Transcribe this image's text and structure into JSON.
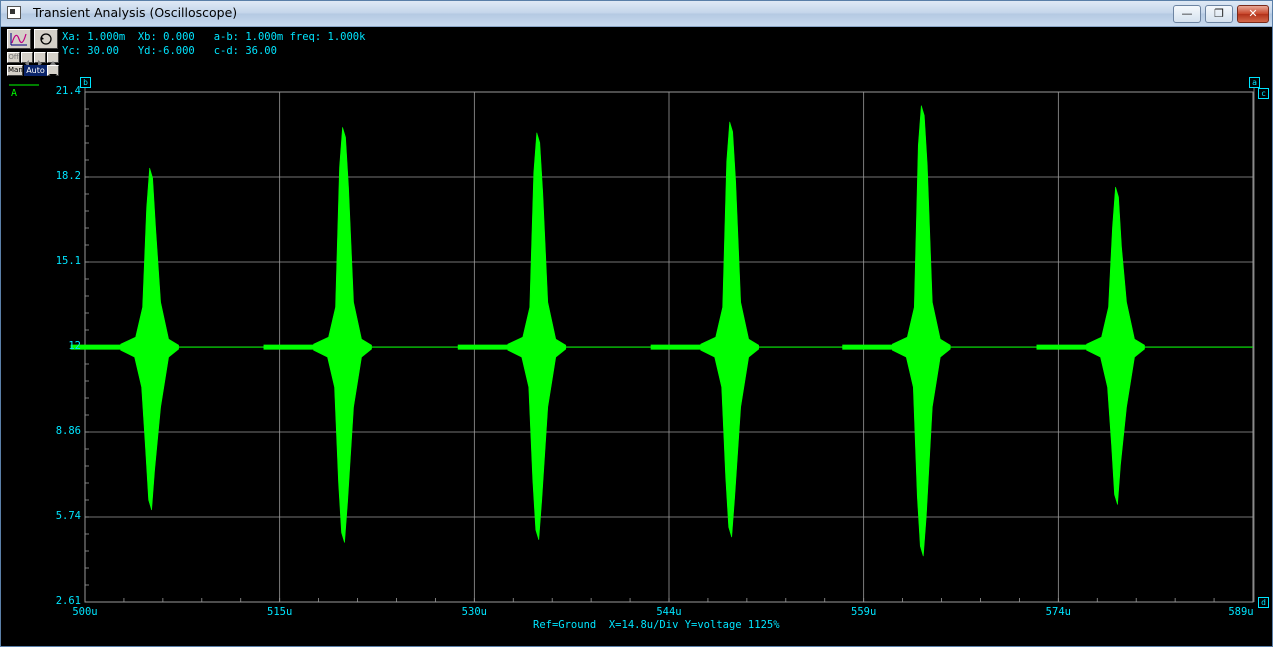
{
  "window": {
    "title": "Transient Analysis (Oscilloscope)"
  },
  "window_controls": {
    "minimize": "—",
    "maximize": "❐",
    "close": "✕"
  },
  "toolbar": {
    "mode_manual": "Man",
    "mode_auto": "Auto",
    "mode_off": "Off"
  },
  "readout": {
    "line1": "Xa: 1.000m  Xb: 0.000   a-b: 1.000m freq: 1.000k",
    "line2": "Yc: 30.00   Yd:-6.000   c-d: 36.00"
  },
  "channel_label": "A",
  "cursors": {
    "a": "a",
    "b": "b",
    "c": "c",
    "d": "d"
  },
  "y_ticks": [
    "21.4",
    "18.2",
    "15.1",
    "12",
    "8.86",
    "5.74",
    "2.61"
  ],
  "x_ticks": [
    "500u",
    "515u",
    "530u",
    "544u",
    "559u",
    "574u",
    "589u"
  ],
  "footer": "Ref=Ground  X=14.8u/Div Y=voltage 1125%",
  "colors": {
    "background": "#000000",
    "trace": "#00ff00",
    "grid": "#9a9a9a",
    "text": "#00e5ff"
  },
  "chart_data": {
    "type": "line",
    "series": [
      {
        "bursts": [
          {
            "t": 505.0,
            "max": 18.6,
            "min": 6.0
          },
          {
            "t": 519.7,
            "max": 20.1,
            "min": 4.8
          },
          {
            "t": 534.5,
            "max": 19.9,
            "min": 4.9
          },
          {
            "t": 549.2,
            "max": 20.3,
            "min": 5.0
          },
          {
            "t": 563.8,
            "max": 20.9,
            "min": 4.3
          },
          {
            "t": 578.6,
            "max": 17.9,
            "min": 6.2
          }
        ],
        "baseline": 12
      }
    ],
    "xlim": [
      500,
      589
    ],
    "ylim": [
      2.61,
      21.4
    ],
    "grid": true
  }
}
